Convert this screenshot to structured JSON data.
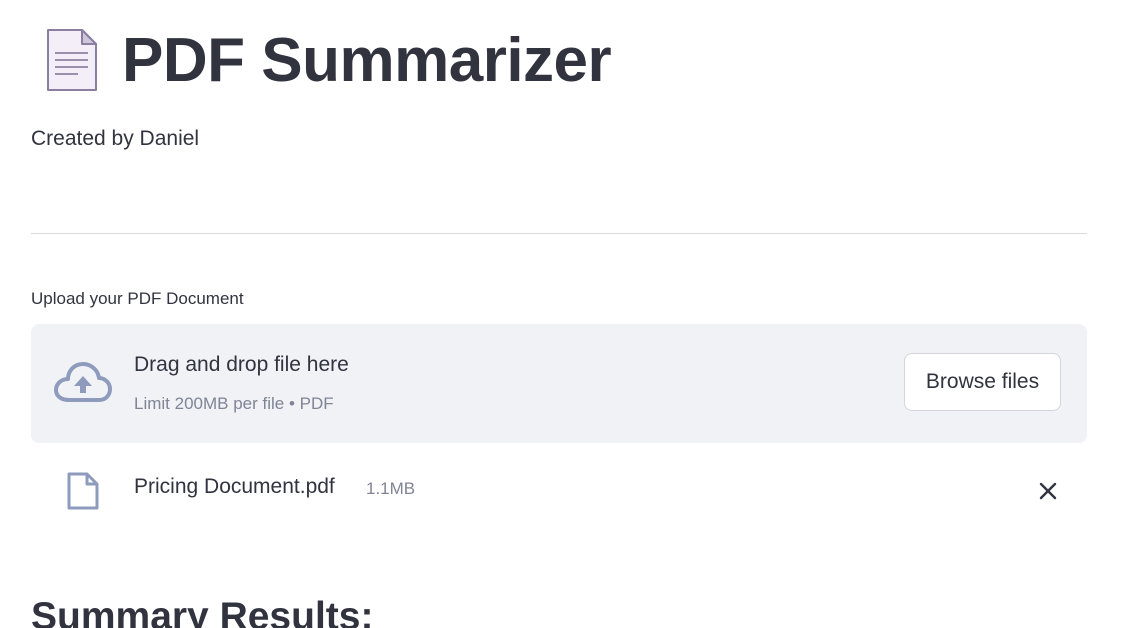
{
  "header": {
    "icon": "page-facing-up-icon",
    "title": "PDF Summarizer",
    "byline": "Created by Daniel"
  },
  "uploader": {
    "label": "Upload your PDF Document",
    "drop_text": "Drag and drop file here",
    "limit_text": "Limit 200MB per file • PDF",
    "browse_label": "Browse files",
    "upload_icon": "cloud-upload-icon"
  },
  "uploaded_file": {
    "icon": "file-icon",
    "name": "Pricing Document.pdf",
    "size": "1.1MB",
    "remove_icon": "close-icon"
  },
  "results": {
    "heading": "Summary Results:"
  },
  "colors": {
    "text": "#31333f",
    "muted": "#808495",
    "dropzone_bg": "#f0f2f6",
    "icon_accent": "#8e9bbc"
  }
}
